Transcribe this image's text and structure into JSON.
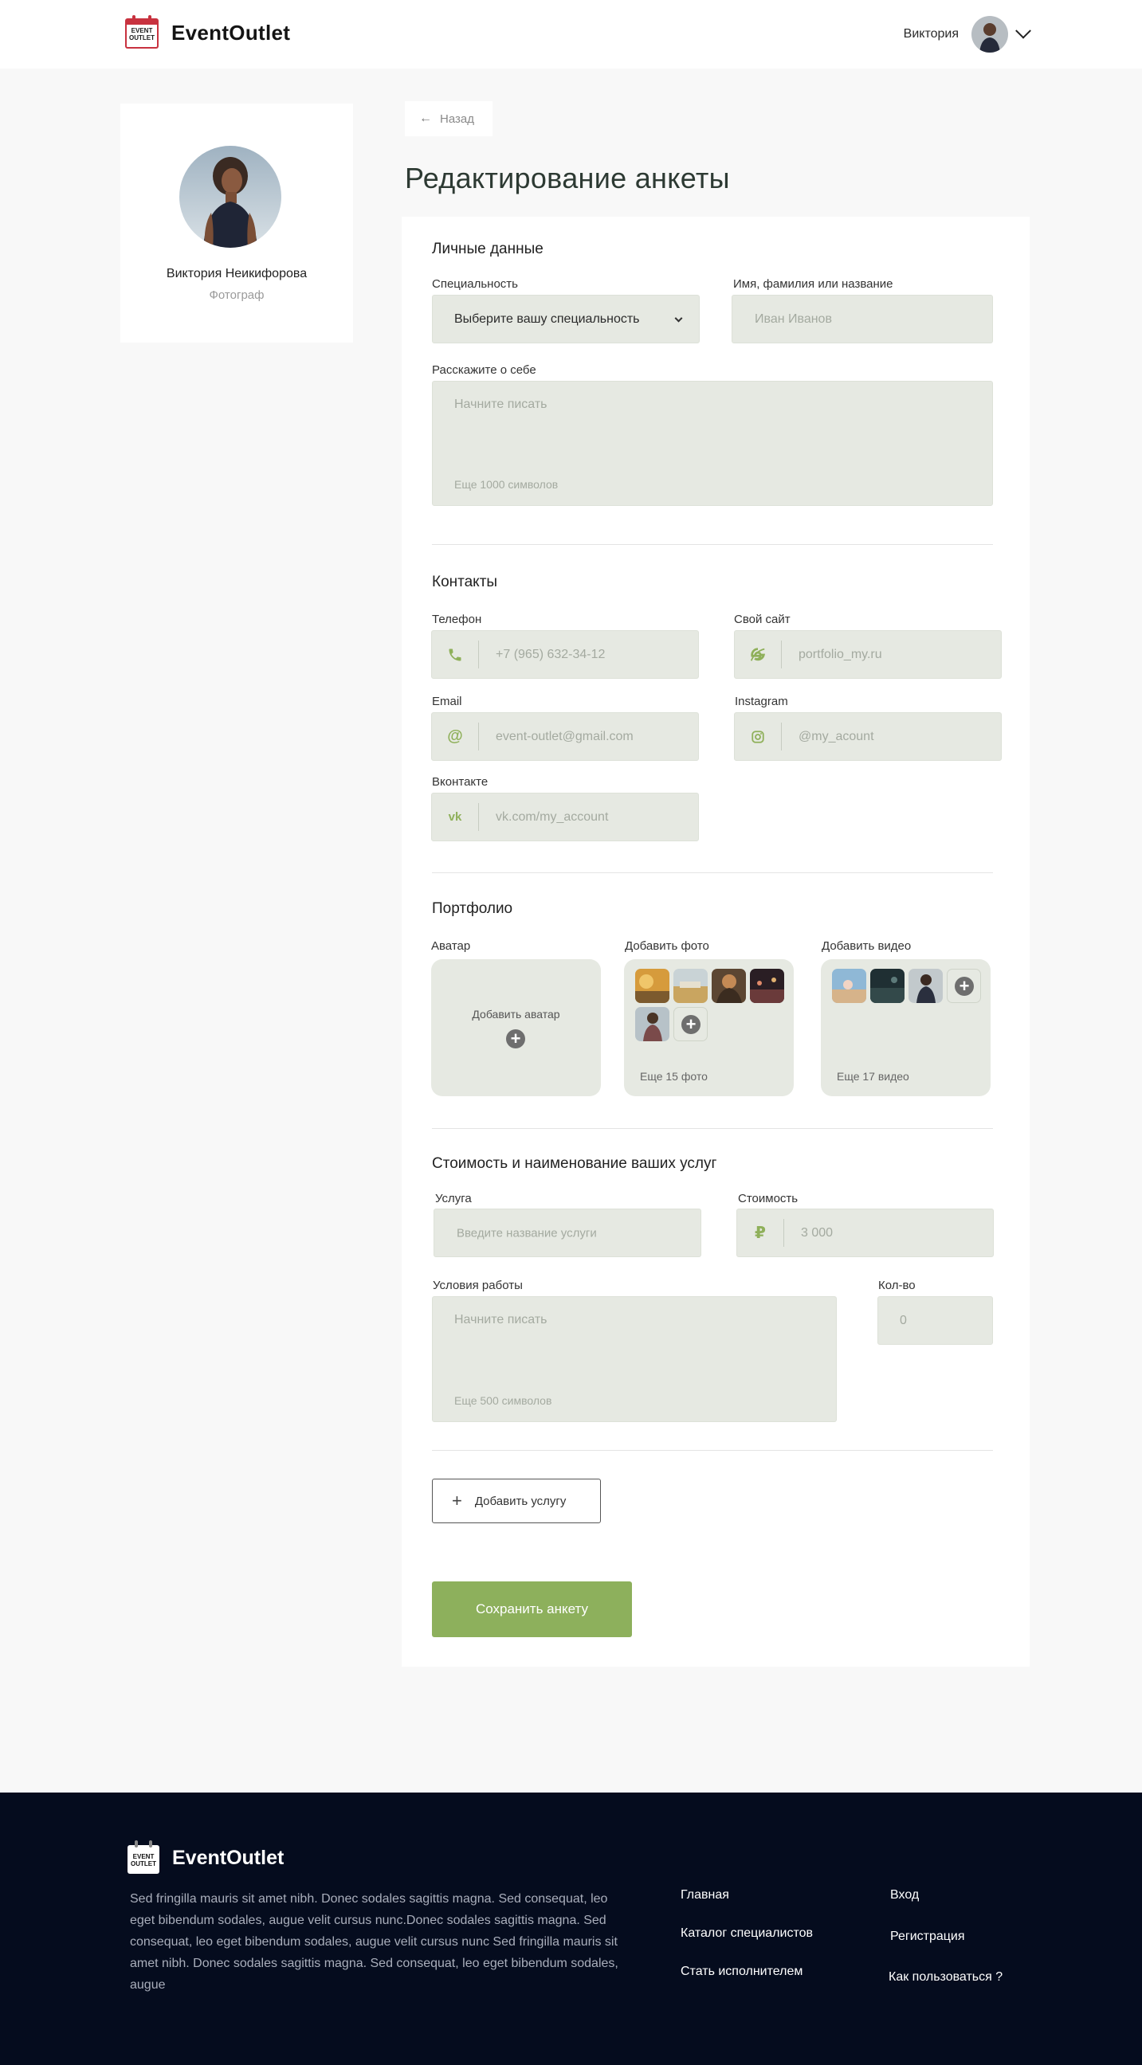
{
  "header": {
    "brand": "EventOutlet",
    "logo_text_line1": "EVENT",
    "logo_text_line2": "OUTLET",
    "user_name": "Виктория"
  },
  "profile": {
    "name": "Виктория Неикифорова",
    "role": "Фотограф"
  },
  "nav": {
    "back_label": "Назад"
  },
  "page_title": "Редактирование анкеты",
  "personal": {
    "title": "Личные данные",
    "specialty_label": "Специальность",
    "specialty_value": "Выберите вашу специальность",
    "name_label": "Имя, фамилия или название",
    "name_placeholder": "Иван Иванов",
    "about_label": "Расскажите о себе",
    "about_placeholder": "Начните писать",
    "about_hint": "Еще 1000 символов"
  },
  "contacts": {
    "title": "Контакты",
    "phone_label": "Телефон",
    "phone_placeholder": "+7 (965) 632-34-12",
    "site_label": "Свой сайт",
    "site_placeholder": "portfolio_my.ru",
    "email_label": "Email",
    "email_placeholder": "event-outlet@gmail.com",
    "instagram_label": "Instagram",
    "instagram_placeholder": "@my_acount",
    "vk_label": "Вконтакте",
    "vk_placeholder": "vk.com/my_account",
    "icons": {
      "phone": "phone-icon",
      "site": "internet-explorer-icon",
      "email": "at-sign-icon",
      "instagram": "instagram-icon",
      "vk": "vk-icon"
    }
  },
  "portfolio": {
    "title": "Портфолио",
    "avatar_label": "Аватар",
    "avatar_add": "Добавить аватар",
    "photo_label": "Добавить фото",
    "photo_hint": "Еще 15 фото",
    "video_label": "Добавить видео",
    "video_hint": "Еще 17 видео"
  },
  "services": {
    "title": "Стоимость и наименование ваших услуг",
    "service_label": "Услуга",
    "service_placeholder": "Введите название услуги",
    "price_label": "Стоимость",
    "price_placeholder": "3 000",
    "currency_icon": "ruble-icon",
    "terms_label": "Условия работы",
    "terms_placeholder": "Начните писать",
    "terms_hint": "Еще 500 символов",
    "qty_label": "Кол-во",
    "qty_placeholder": "0",
    "add_service": "Добавить услугу",
    "save": "Сохранить анкету"
  },
  "footer": {
    "brand": "EventOutlet",
    "logo_text_line1": "EVENT",
    "logo_text_line2": "OUTLET",
    "description": "Sed fringilla mauris sit amet nibh. Donec sodales sagittis magna. Sed consequat, leo eget bibendum sodales, augue velit cursus nunc.Donec sodales sagittis magna. Sed consequat, leo eget bibendum sodales, augue velit cursus nunc Sed fringilla mauris sit amet nibh. Donec sodales sagittis magna. Sed consequat, leo eget bibendum sodales, augue",
    "links_col1": [
      "Главная",
      "Каталог специалистов",
      "Стать исполнителем"
    ],
    "links_col2": [
      "Вход",
      "Регистрация",
      "Как пользоваться ?"
    ]
  },
  "colors": {
    "accent": "#8db05c",
    "field_bg": "#e6e9e2",
    "footer_bg": "#050c1e",
    "logo_red": "#c8323f"
  }
}
